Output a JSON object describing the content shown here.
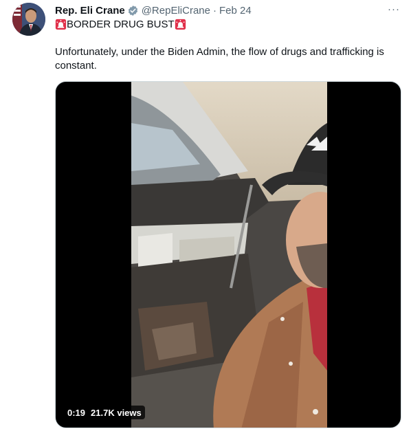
{
  "author": {
    "name": "Rep. Eli Crane",
    "handle": "@RepEliCrane",
    "separator": "·",
    "date": "Feb 24",
    "verified_icon": "verified-badge-icon",
    "verified_color": "#829aab"
  },
  "tweet": {
    "headline": "BORDER DRUG BUST",
    "headline_icon": "rotating-light-icon",
    "body": "Unfortunately, under the Biden Admin, the flow of drugs and trafficking is constant."
  },
  "menu": {
    "more_label": "···"
  },
  "video": {
    "duration": "0:19",
    "views": "21.7K views"
  },
  "colors": {
    "text": "#0f1419",
    "secondary": "#536471",
    "siren_red": "#e0304a"
  }
}
